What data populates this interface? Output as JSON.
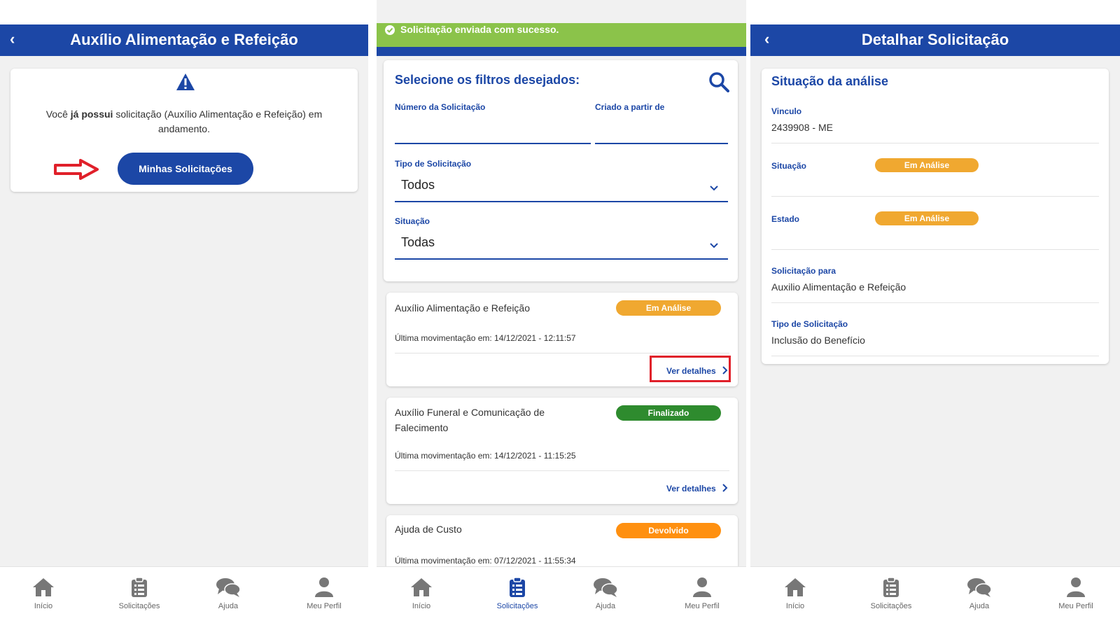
{
  "panel1": {
    "header_title": "Auxílio Alimentação e Refeição",
    "alert": {
      "text_before": "Você ",
      "text_bold": "já possui",
      "text_after": " solicitação (Auxílio Alimentação e Refeição) em andamento."
    },
    "button_label": "Minhas Solicitações"
  },
  "panel2": {
    "toast_text": "Solicitação enviada com sucesso.",
    "filters": {
      "title": "Selecione os filtros desejados:",
      "numero_label": "Número da Solicitação",
      "criado_label": "Criado a partir de",
      "tipo_label": "Tipo de Solicitação",
      "tipo_value": "Todos",
      "situacao_label": "Situação",
      "situacao_value": "Todas"
    },
    "requests": [
      {
        "title": "Auxílio Alimentação e Refeição",
        "status": "Em Análise",
        "status_color": "#f0a830",
        "movement": "Última movimentação em: 14/12/2021 - 12:11:57",
        "link": "Ver detalhes"
      },
      {
        "title": "Auxílio Funeral e Comunicação de Falecimento",
        "status": "Finalizado",
        "status_color": "#2e8b2e",
        "movement": "Última movimentação em: 14/12/2021 - 11:15:25",
        "link": "Ver detalhes"
      },
      {
        "title": "Ajuda de Custo",
        "status": "Devolvido",
        "status_color": "#ff9010",
        "movement": "Última movimentação em: 07/12/2021 - 11:55:34"
      }
    ]
  },
  "panel3": {
    "header_title": "Detalhar Solicitação",
    "section_title": "Situação da análise",
    "vinculo_label": "Vinculo",
    "vinculo_value": "2439908 - ME",
    "situacao_label": "Situação",
    "situacao_badge": "Em Análise",
    "estado_label": "Estado",
    "estado_badge": "Em Análise",
    "solicitacao_para_label": "Solicitação para",
    "solicitacao_para_value": "Auxilio Alimentação e Refeição",
    "tipo_label": "Tipo de Solicitação",
    "tipo_value": "Inclusão do Benefício"
  },
  "nav": {
    "inicio": "Início",
    "solicitacoes": "Solicitações",
    "ajuda": "Ajuda",
    "perfil": "Meu Perfil"
  },
  "colors": {
    "primary": "#1c47a6",
    "toast_green": "#8bc34a",
    "badge_orange": "#f0a830",
    "badge_green": "#2e8b2e",
    "badge_devolvido": "#ff9010",
    "highlight_red": "#e0202a"
  },
  "icons": [
    "back-arrow-icon",
    "warning-icon",
    "red-arrow-icon",
    "check-circle-icon",
    "search-icon",
    "chevron-down-icon",
    "chevron-right-icon",
    "home-icon",
    "clipboard-icon",
    "chat-icon",
    "user-icon"
  ]
}
